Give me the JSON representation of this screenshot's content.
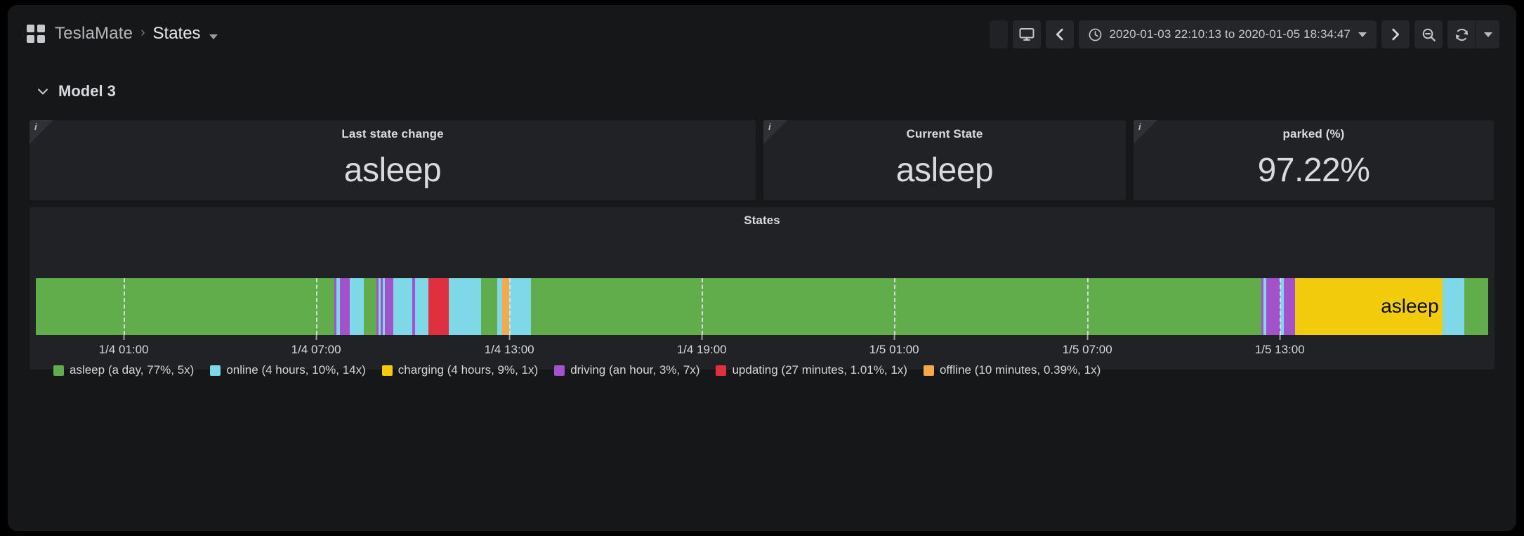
{
  "nav": {
    "grid_icon": "grid-icon",
    "brand": "TeslaMate",
    "separator": "›",
    "current": "States",
    "caret_icon": "chevron-down-icon"
  },
  "toolbar": {
    "blank_label": "",
    "tv_icon": "🖵",
    "prev_icon": "‹",
    "next_icon": "›",
    "clock_icon": "clock-icon",
    "time_range": "2020-01-03 22:10:13 to 2020-01-05 18:34:47",
    "zoom_out_icon": "zoom-out-icon",
    "refresh_icon": "refresh-icon",
    "refresh_caret_icon": "chevron-down-icon"
  },
  "row": {
    "chevron_icon": "chevron-down-icon",
    "title": "Model 3"
  },
  "stats": [
    {
      "title": "Last state change",
      "value": "asleep",
      "info_glyph": "i"
    },
    {
      "title": "Current State",
      "value": "asleep",
      "info_glyph": "i"
    },
    {
      "title": "parked (%)",
      "value": "97.22%",
      "info_glyph": "i"
    }
  ],
  "states_panel": {
    "title": "States",
    "overlay_label": "asleep"
  },
  "chart_data": {
    "type": "bar",
    "title": "States",
    "xlabel": "",
    "ylabel": "",
    "grid": true,
    "legend_position": "bottom",
    "x_ticks": [
      {
        "label": "1/4 01:00",
        "pos": 6.05
      },
      {
        "label": "1/4 07:00",
        "pos": 19.3
      },
      {
        "label": "1/4 13:00",
        "pos": 32.6
      },
      {
        "label": "1/4 19:00",
        "pos": 45.85
      },
      {
        "label": "1/5 01:00",
        "pos": 59.1
      },
      {
        "label": "1/5 07:00",
        "pos": 72.4
      },
      {
        "label": "1/5 13:00",
        "pos": 85.65
      }
    ],
    "colors": {
      "asleep": "#62ad4b",
      "online": "#7ed8e8",
      "charging": "#f2cc0c",
      "driving": "#a352cc",
      "updating": "#e0303f",
      "offline": "#f6a94a"
    },
    "legend": [
      {
        "name": "asleep",
        "label": "asleep (a day, 77%, 5x)",
        "color": "#62ad4b",
        "duration": "a day",
        "percent": 77,
        "count": "5x"
      },
      {
        "name": "online",
        "label": "online (4 hours, 10%, 14x)",
        "color": "#7ed8e8",
        "duration": "4 hours",
        "percent": 10,
        "count": "14x"
      },
      {
        "name": "charging",
        "label": "charging (4 hours, 9%, 1x)",
        "color": "#f2cc0c",
        "duration": "4 hours",
        "percent": 9,
        "count": "1x"
      },
      {
        "name": "driving",
        "label": "driving (an hour, 3%, 7x)",
        "color": "#a352cc",
        "duration": "an hour",
        "percent": 3,
        "count": "7x"
      },
      {
        "name": "updating",
        "label": "updating (27 minutes, 1.01%, 1x)",
        "color": "#e0303f",
        "duration": "27 minutes",
        "percent": 1.01,
        "count": "1x"
      },
      {
        "name": "offline",
        "label": "offline (10 minutes, 0.39%, 1x)",
        "color": "#f6a94a",
        "duration": "10 minutes",
        "percent": 0.39,
        "count": "1x"
      }
    ],
    "segments": [
      {
        "state": "asleep",
        "start": 0.0,
        "end": 20.55
      },
      {
        "state": "driving",
        "start": 20.55,
        "end": 20.72
      },
      {
        "state": "online",
        "start": 20.72,
        "end": 20.95
      },
      {
        "state": "driving",
        "start": 20.95,
        "end": 21.62
      },
      {
        "state": "online",
        "start": 21.62,
        "end": 22.6
      },
      {
        "state": "asleep",
        "start": 22.6,
        "end": 23.45
      },
      {
        "state": "driving",
        "start": 23.45,
        "end": 23.6
      },
      {
        "state": "online",
        "start": 23.6,
        "end": 23.72
      },
      {
        "state": "driving",
        "start": 23.72,
        "end": 23.88
      },
      {
        "state": "online",
        "start": 23.88,
        "end": 24.05
      },
      {
        "state": "driving",
        "start": 24.05,
        "end": 24.62
      },
      {
        "state": "online",
        "start": 24.62,
        "end": 25.92
      },
      {
        "state": "driving",
        "start": 25.92,
        "end": 26.12
      },
      {
        "state": "online",
        "start": 26.12,
        "end": 27.05
      },
      {
        "state": "updating",
        "start": 27.05,
        "end": 28.42
      },
      {
        "state": "online",
        "start": 28.42,
        "end": 30.65
      },
      {
        "state": "asleep",
        "start": 30.65,
        "end": 31.75
      },
      {
        "state": "online",
        "start": 31.75,
        "end": 32.12
      },
      {
        "state": "offline",
        "start": 32.12,
        "end": 32.6
      },
      {
        "state": "online",
        "start": 32.6,
        "end": 34.1
      },
      {
        "state": "asleep",
        "start": 34.1,
        "end": 84.4
      },
      {
        "state": "driving",
        "start": 84.4,
        "end": 84.55
      },
      {
        "state": "online",
        "start": 84.55,
        "end": 84.7
      },
      {
        "state": "driving",
        "start": 84.7,
        "end": 85.7
      },
      {
        "state": "online",
        "start": 85.7,
        "end": 85.95
      },
      {
        "state": "driving",
        "start": 85.95,
        "end": 86.7
      },
      {
        "state": "charging",
        "start": 86.7,
        "end": 96.85
      },
      {
        "state": "online",
        "start": 96.85,
        "end": 98.35
      },
      {
        "state": "asleep",
        "start": 98.35,
        "end": 100.0
      }
    ]
  }
}
